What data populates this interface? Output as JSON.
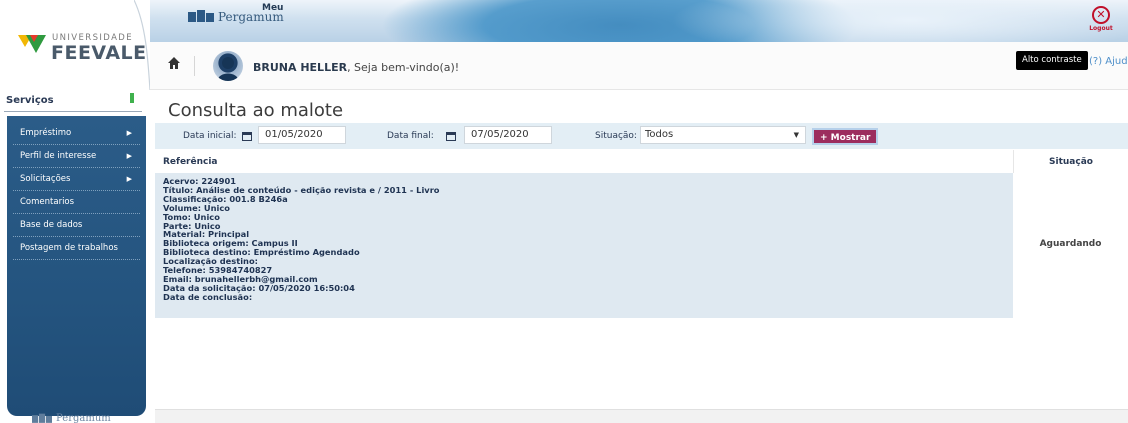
{
  "brand": {
    "university_top": "UNIVERSIDADE",
    "university_name": "FEEVALE",
    "app_meu": "Meu",
    "app_name": "Pergamum",
    "logout_label": "Logout"
  },
  "userbar": {
    "user_name": "BRUNA HELLER",
    "greeting_suffix": ", Seja bem-vindo(a)!",
    "contrast_label": "Alto contraste",
    "help_label": "(?) Ajuda"
  },
  "sidebar": {
    "header": "Serviços",
    "items": [
      {
        "label": "Empréstimo",
        "has_arrow": true
      },
      {
        "label": "Perfil de interesse",
        "has_arrow": true
      },
      {
        "label": "Solicitações",
        "has_arrow": true
      },
      {
        "label": "Comentarios",
        "has_arrow": false
      },
      {
        "label": "Base de dados",
        "has_arrow": false
      },
      {
        "label": "Postagem de trabalhos",
        "has_arrow": false
      }
    ],
    "footer_brand": "Pergamum"
  },
  "main": {
    "title": "Consulta ao malote",
    "filters": {
      "start_label": "Data inicial:",
      "start_value": "01/05/2020",
      "end_label": "Data final:",
      "end_value": "07/05/2020",
      "status_label": "Situação:",
      "status_value": "Todos",
      "submit_label": "+ Mostrar"
    },
    "table": {
      "col_reference": "Referência",
      "col_status": "Situação",
      "rows": [
        {
          "reference_lines": [
            "Acervo: 224901",
            "Título: Análise de conteúdo - edição revista e / 2011 - Livro",
            "Classificação: 001.8 B246a",
            "Volume: Unico",
            "Tomo: Unico",
            "Parte: Unico",
            "Material: Principal",
            "Biblioteca origem: Campus II",
            "Biblioteca destino: Empréstimo Agendado",
            "Localização destino:",
            "Telefone: 53984740827",
            "Email: brunahellerbh@gmail.com",
            "Data da solicitação: 07/05/2020 16:50:04",
            "Data de conclusão:"
          ],
          "status": "Aguardando"
        }
      ]
    }
  },
  "colors": {
    "sidebar_bg": "#24547f",
    "button_bg": "#9c2d5e",
    "filter_bg": "#e3eef5",
    "row_bg": "#dfe9f1",
    "logout_red": "#c0102a"
  }
}
